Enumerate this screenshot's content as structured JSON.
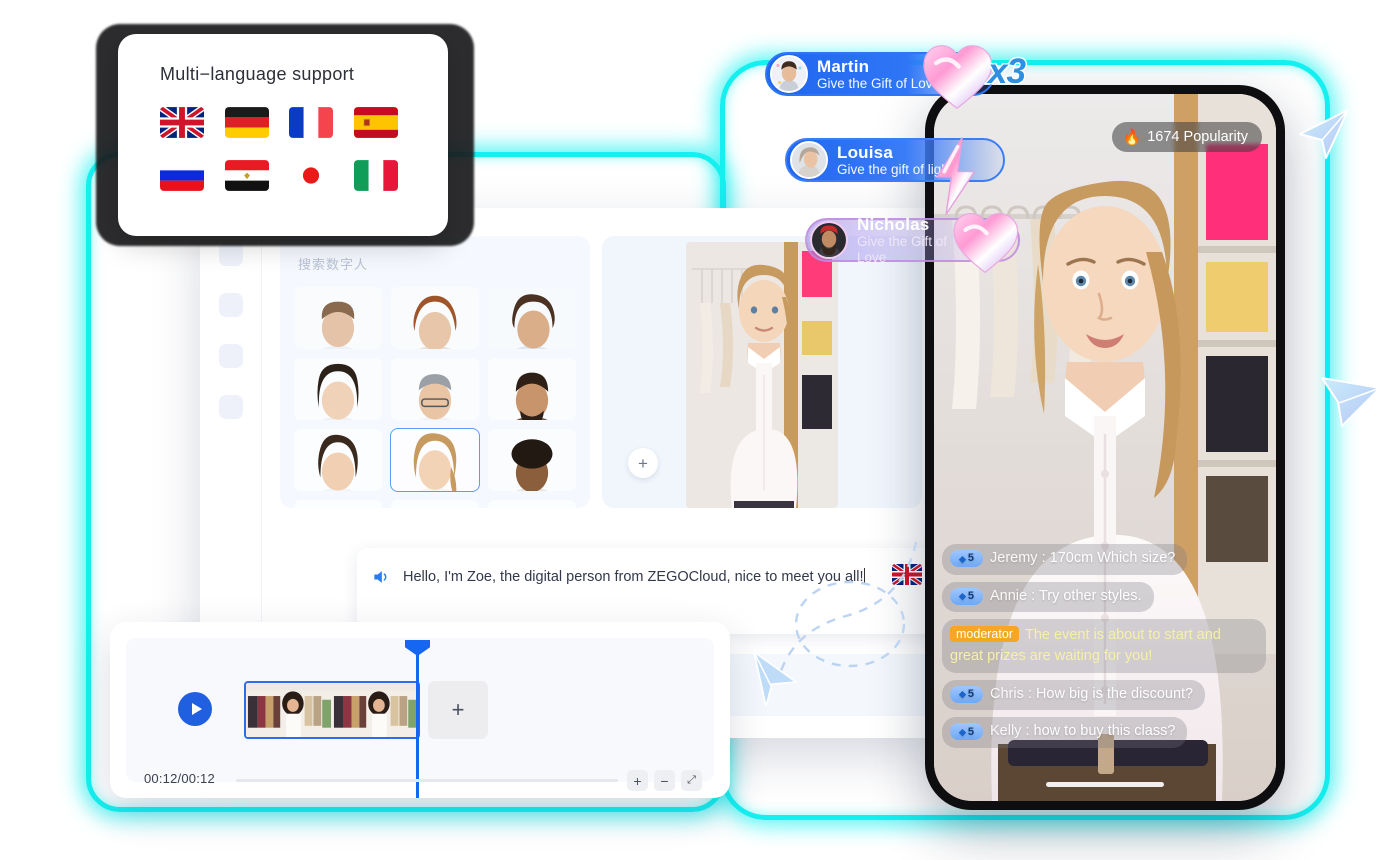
{
  "language_card": {
    "title": "Multi−language support",
    "flags": [
      {
        "name": "flag-uk",
        "label": "United Kingdom"
      },
      {
        "name": "flag-germany",
        "label": "Germany"
      },
      {
        "name": "flag-france",
        "label": "France"
      },
      {
        "name": "flag-spain",
        "label": "Spain"
      },
      {
        "name": "flag-russia",
        "label": "Russia"
      },
      {
        "name": "flag-egypt",
        "label": "Egypt"
      },
      {
        "name": "flag-japan",
        "label": "Japan"
      },
      {
        "name": "flag-italy",
        "label": "Italy"
      }
    ]
  },
  "app": {
    "sidebar_items": [
      "item-1",
      "item-2",
      "item-3",
      "item-4"
    ],
    "avatar_panel": {
      "search_placeholder": "搜索数字人",
      "selected_index": 7,
      "avatars": [
        "young-man-white-shirt",
        "curly-red-hair-woman",
        "long-dark-hair-woman",
        "black-hair-woman",
        "bearded-man-glasses",
        "bearded-man-brown-shirt",
        "short-hair-woman",
        "blonde-woman-selected",
        "curly-hair-man",
        "row4-a",
        "row4-b",
        "row4-c"
      ]
    },
    "preview": {
      "add_button_label": "+"
    },
    "script": {
      "text": "Hello, I'm Zoe, the digital person from ZEGOCloud, nice to meet you all!",
      "speaker_icon": "speaker-icon",
      "language_flag": "flag-uk"
    }
  },
  "timeline": {
    "play_icon": "play-icon",
    "add_clip_label": "+",
    "time_display": "00:12/00:12",
    "controls": [
      {
        "name": "zoom-in-button",
        "label": "+"
      },
      {
        "name": "zoom-out-button",
        "label": "−"
      },
      {
        "name": "fit-button",
        "label": "⤢"
      }
    ]
  },
  "phone": {
    "popularity": {
      "icon": "flame-icon",
      "text": "1674 Popularity"
    },
    "chat_messages": [
      {
        "type": "user",
        "level": "5",
        "name": "Jeremy",
        "separator": ":",
        "text": "170cm Which size?"
      },
      {
        "type": "user",
        "level": "5",
        "name": "Annie",
        "separator": ":",
        "text": "Try other styles."
      },
      {
        "type": "moderator",
        "tag": "moderator",
        "text": "The event is about to start and great prizes are waiting for you!"
      },
      {
        "type": "user",
        "level": "5",
        "name": "Chris",
        "separator": ":",
        "text": "How big is the discount?"
      },
      {
        "type": "user",
        "level": "5",
        "name": "Kelly",
        "separator": ":",
        "text": "how to buy this class?"
      }
    ]
  },
  "gifts": [
    {
      "name": "Martin",
      "subtitle": "Give the Gift of Love",
      "gift_icon": "heart-gift",
      "multiplier": "x3"
    },
    {
      "name": "Louisa",
      "subtitle": "Give the gift of light",
      "gift_icon": "lightning-gift",
      "multiplier": ""
    },
    {
      "name": "Nicholas",
      "subtitle": "Give the Gift of Love",
      "gift_icon": "heart-gift",
      "multiplier": ""
    }
  ],
  "colors": {
    "accent_cyan": "#14f0f0",
    "accent_blue": "#1f66f0",
    "moderator_tag": "#f5a623",
    "moderator_text": "#f7f0a8"
  }
}
